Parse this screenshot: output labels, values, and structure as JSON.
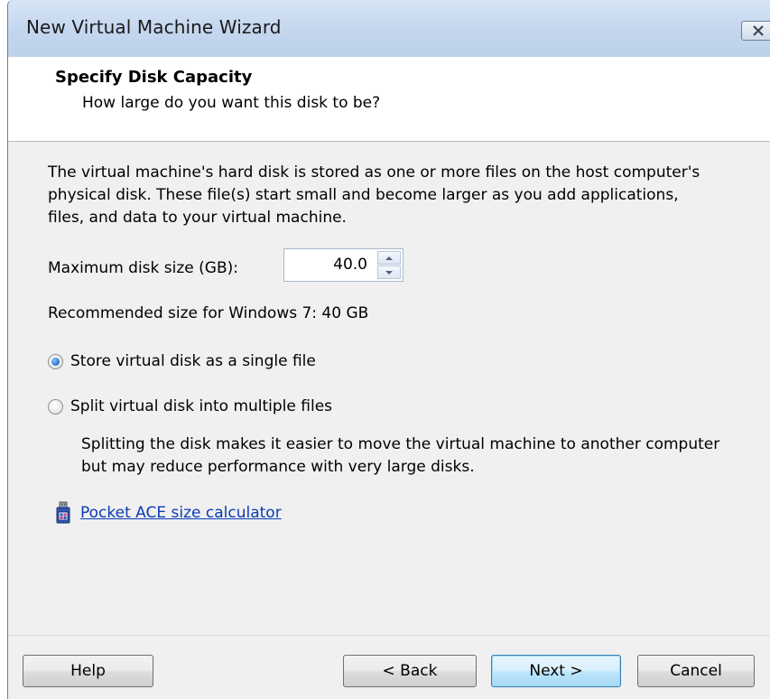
{
  "window": {
    "title": "New Virtual Machine Wizard"
  },
  "header": {
    "title": "Specify Disk Capacity",
    "subtitle": "How large do you want this disk to be?"
  },
  "content": {
    "description": "The virtual machine's hard disk is stored as one or more files on the host computer's physical disk. These file(s) start small and become larger as you add applications, files, and data to your virtual machine.",
    "disk_size_label": "Maximum disk size (GB):",
    "disk_size_value": "40.0",
    "recommended": "Recommended size for Windows 7: 40 GB",
    "options": [
      {
        "label": "Store virtual disk as a single file",
        "selected": true
      },
      {
        "label": "Split virtual disk into multiple files",
        "selected": false
      }
    ],
    "split_description": "Splitting the disk makes it easier to move the virtual machine to another computer but may reduce performance with very large disks.",
    "calculator_link": "Pocket ACE size calculator",
    "calculator_icon": "usb-drive-icon"
  },
  "buttons": {
    "help": "Help",
    "back": "< Back",
    "next": "Next >",
    "cancel": "Cancel"
  },
  "colors": {
    "link": "#0a3ab6",
    "titlebar": "#c3d6ee",
    "content_bg": "#f0f0f0"
  }
}
